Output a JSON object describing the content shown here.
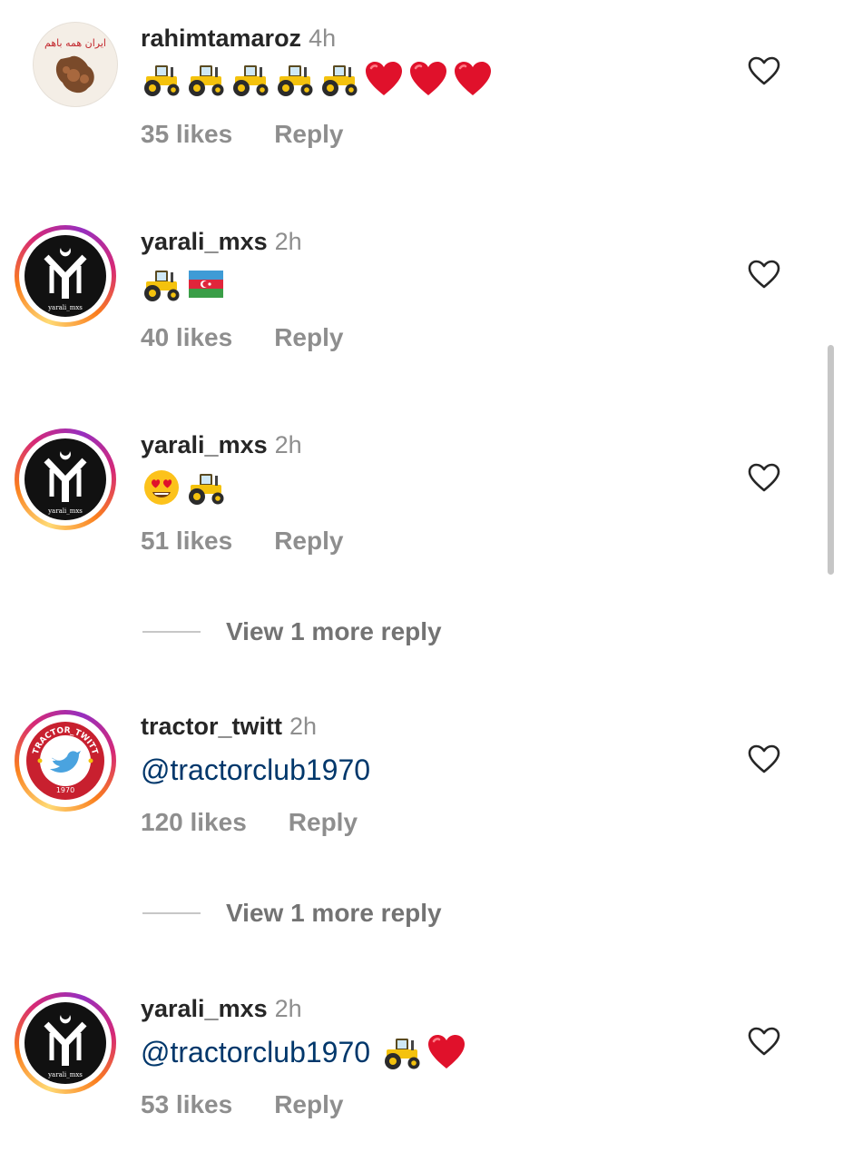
{
  "comments": [
    {
      "username": "rahimtamaroz",
      "time": "4h",
      "likes": "35 likes",
      "reply": "Reply",
      "emojis": [
        "tractor",
        "tractor",
        "tractor",
        "tractor",
        "tractor",
        "red-heart",
        "red-heart",
        "red-heart"
      ],
      "avatar_text": "ایران همه باهم"
    },
    {
      "username": "yarali_mxs",
      "time": "2h",
      "likes": "40 likes",
      "reply": "Reply",
      "emojis": [
        "tractor",
        "azerbaijan-flag"
      ],
      "avatar_text": "yarali_mxs"
    },
    {
      "username": "yarali_mxs",
      "time": "2h",
      "likes": "51 likes",
      "reply": "Reply",
      "emojis": [
        "heart-eyes",
        "tractor"
      ],
      "avatar_text": "yarali_mxs"
    },
    {
      "username": "tractor_twitt",
      "time": "2h",
      "text": "@tractorclub1970",
      "likes": "120 likes",
      "reply": "Reply",
      "avatar_text": "TRACTOR_TWITT",
      "avatar_year": "1970"
    },
    {
      "username": "yarali_mxs",
      "time": "2h",
      "text": "@tractorclub1970",
      "likes": "53 likes",
      "reply": "Reply",
      "emojis": [
        "tractor",
        "red-heart"
      ],
      "avatar_text": "yarali_mxs"
    }
  ],
  "view_more": [
    {
      "label": "View 1 more reply"
    },
    {
      "label": "View 1 more reply"
    }
  ],
  "colors": {
    "text": "#262626",
    "secondary": "#8e8e8e",
    "mention": "#00376b",
    "heart_emoji": "#e0112b",
    "tractor_yellow": "#f4c20d"
  },
  "icons": {
    "like": "heart-outline-icon"
  }
}
